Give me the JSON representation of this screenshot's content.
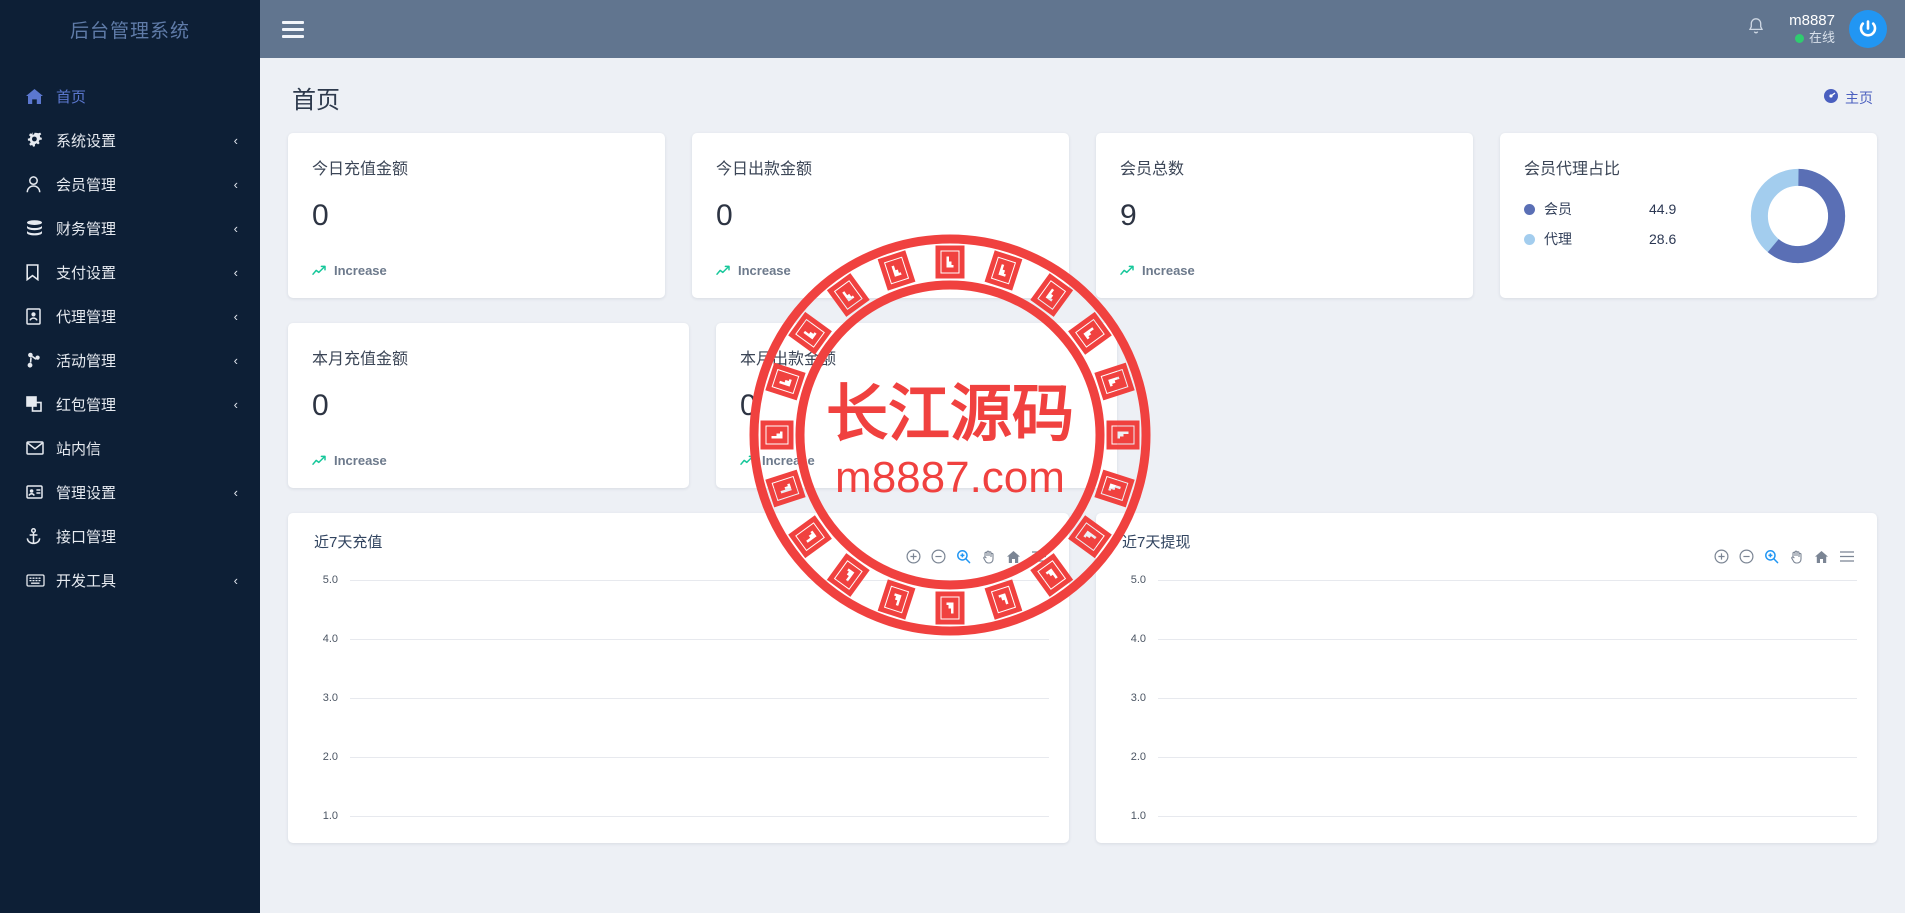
{
  "brand": {
    "title": "后台管理系统"
  },
  "sidebar": {
    "items": [
      {
        "label": "首页",
        "icon": "home-icon",
        "caret": "",
        "active": true
      },
      {
        "label": "系统设置",
        "icon": "gears-icon",
        "caret": "‹",
        "active": false
      },
      {
        "label": "会员管理",
        "icon": "user-icon",
        "caret": "‹",
        "active": false
      },
      {
        "label": "财务管理",
        "icon": "database-icon",
        "caret": "‹",
        "active": false
      },
      {
        "label": "支付设置",
        "icon": "bookmark-icon",
        "caret": "‹",
        "active": false
      },
      {
        "label": "代理管理",
        "icon": "contact-card-icon",
        "caret": "‹",
        "active": false
      },
      {
        "label": "活动管理",
        "icon": "sitemap-icon",
        "caret": "‹",
        "active": false
      },
      {
        "label": "红包管理",
        "icon": "clone-icon",
        "caret": "‹",
        "active": false
      },
      {
        "label": "站内信",
        "icon": "envelope-icon",
        "caret": "",
        "active": false
      },
      {
        "label": "管理设置",
        "icon": "id-card-icon",
        "caret": "‹",
        "active": false
      },
      {
        "label": "接口管理",
        "icon": "anchor-icon",
        "caret": "",
        "active": false
      },
      {
        "label": "开发工具",
        "icon": "keyboard-icon",
        "caret": "‹",
        "active": false
      }
    ]
  },
  "topbar": {
    "menu_toggle": "hamburger-icon",
    "notification_icon": "bell-icon",
    "user_name": "m8887",
    "user_status": "在线",
    "avatar_icon": "power-icon"
  },
  "page": {
    "title": "首页",
    "breadcrumb_label": "主页",
    "breadcrumb_icon": "dashboard-icon"
  },
  "stats": [
    {
      "title": "今日充值金额",
      "value": "0",
      "foot": "Increase"
    },
    {
      "title": "今日出款金额",
      "value": "0",
      "foot": "Increase"
    },
    {
      "title": "会员总数",
      "value": "9",
      "foot": "Increase"
    },
    {
      "title": "本月充值金额",
      "value": "0",
      "foot": "Increase"
    },
    {
      "title": "本月出款金额",
      "value": "0",
      "foot": "Increase"
    }
  ],
  "donut": {
    "title": "会员代理占比",
    "legend": [
      {
        "name": "会员",
        "value": "44.9",
        "color": "#5a6fb5"
      },
      {
        "name": "代理",
        "value": "28.6",
        "color": "#a3cdee"
      }
    ]
  },
  "charts": [
    {
      "title": "近7天充值",
      "yticks": [
        "5.0",
        "4.0",
        "3.0",
        "2.0",
        "1.0"
      ]
    },
    {
      "title": "近7天提现",
      "yticks": [
        "5.0",
        "4.0",
        "3.0",
        "2.0",
        "1.0"
      ]
    }
  ],
  "chart_toolbar": [
    {
      "name": "zoom-in-icon",
      "active": false
    },
    {
      "name": "zoom-out-icon",
      "active": false
    },
    {
      "name": "selection-zoom-icon",
      "active": true
    },
    {
      "name": "pan-icon",
      "active": false
    },
    {
      "name": "reset-home-icon",
      "active": false
    },
    {
      "name": "menu-icon",
      "active": false
    }
  ],
  "watermark": {
    "text_main": "长江源码",
    "text_sub": "m8887.com",
    "color": "#f0413f"
  },
  "chart_data": [
    {
      "type": "line",
      "title": "近7天充值",
      "categories": [],
      "values": [],
      "xlabel": "",
      "ylabel": "",
      "ylim": [
        1.0,
        5.0
      ],
      "ytick_values": [
        5.0,
        4.0,
        3.0,
        2.0,
        1.0
      ],
      "grid": true,
      "legend": "none"
    },
    {
      "type": "line",
      "title": "近7天提现",
      "categories": [],
      "values": [],
      "xlabel": "",
      "ylabel": "",
      "ylim": [
        1.0,
        5.0
      ],
      "ytick_values": [
        5.0,
        4.0,
        3.0,
        2.0,
        1.0
      ],
      "grid": true,
      "legend": "none"
    },
    {
      "type": "pie",
      "title": "会员代理占比",
      "categories": [
        "会员",
        "代理"
      ],
      "values": [
        44.9,
        28.6
      ],
      "colors": [
        "#5a6fb5",
        "#a3cdee"
      ],
      "legend": "left"
    }
  ]
}
